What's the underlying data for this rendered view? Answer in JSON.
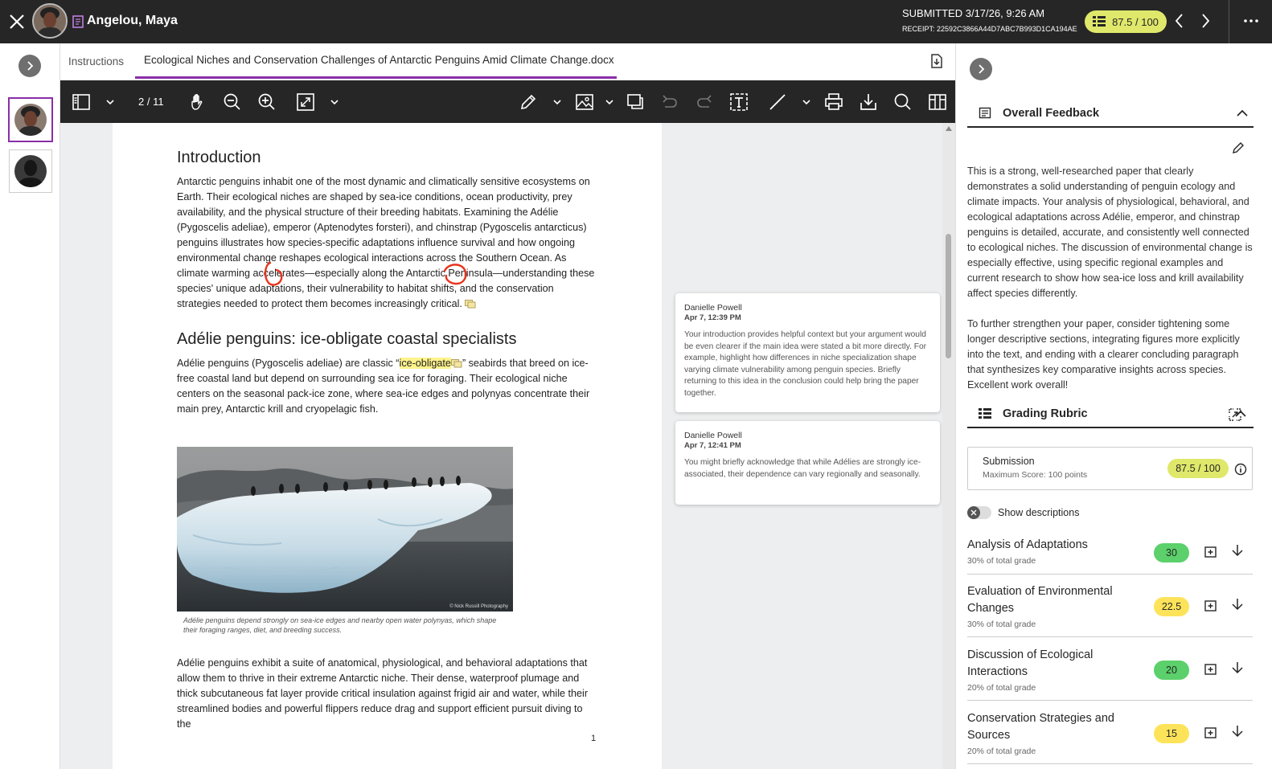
{
  "header": {
    "student_name": "Angelou, Maya",
    "submitted": "SUBMITTED 3/17/26, 9:26 AM",
    "receipt": "RECEIPT: 22592C3866A44D7ABC7B993D1CA194AE",
    "grade": "87.5 / 100"
  },
  "tabs": {
    "instructions": "Instructions",
    "document": "Ecological Niches and Conservation Challenges of Antarctic Penguins Amid Climate Change.docx"
  },
  "toolbar": {
    "page_indicator": "2 / 11"
  },
  "doc": {
    "intro_heading": "Introduction",
    "intro_text": "Antarctic penguins inhabit one of the most dynamic and climatically sensitive ecosystems on Earth. Their ecological niches are shaped by sea-ice conditions, ocean productivity, prey availability, and the physical structure of their breeding habitats. Examining the Adélie (Pygoscelis adeliae), emperor (Aptenodytes forsteri), and chinstrap (Pygoscelis antarcticus) penguins illustrates how species-specific adaptations influence survival and how ongoing environmental change reshapes ecological interactions across the Southern Ocean. As climate warming accelerates—especially along the Antarctic Peninsula—understanding these species' unique adaptations, their vulnerability to habitat shifts, and the conservation strategies needed to protect them becomes increasingly critical.",
    "adelie_heading": "Adélie penguins: ice-obligate coastal specialists",
    "adelie_before": "Adélie penguins (Pygoscelis adeliae) are classic “",
    "adelie_highlight": "ice-obligate",
    "adelie_after": "” seabirds that breed on ice-free coastal land but depend on surrounding sea ice for foraging. Their ecological niche centers on the seasonal pack-ice zone, where sea-ice edges and polynyas concentrate their main prey, Antarctic krill and cryopelagic fish.",
    "photo_credit": "© Nick Russill Photography",
    "caption": "Adélie penguins depend strongly on sea-ice edges and nearby open water polynyas, which shape their foraging ranges, diet, and breeding success.",
    "adaptations_text": "Adélie penguins exhibit a suite of anatomical, physiological, and behavioral adaptations that allow them to thrive in their extreme Antarctic niche. Their dense, waterproof plumage and thick subcutaneous fat layer provide critical insulation against frigid air and water, while their streamlined bodies and powerful flippers reduce drag and support efficient pursuit diving to the",
    "page_number": "1"
  },
  "comments": [
    {
      "author": "Danielle Powell",
      "date": "Apr 7, 12:39 PM",
      "text": "Your introduction provides helpful context but your argument would be even clearer if the main idea were stated a bit more directly. For example, highlight how differences in niche specialization shape varying climate vulnerability among penguin species. Briefly returning to this idea in the conclusion could help bring the paper together."
    },
    {
      "author": "Danielle Powell",
      "date": "Apr 7, 12:41 PM",
      "text": "You might briefly acknowledge that while Adélies are strongly ice-associated, their dependence can vary regionally and seasonally."
    }
  ],
  "feedback": {
    "title": "Overall Feedback",
    "p1": "This is a strong, well-researched paper that clearly demonstrates a solid understanding of penguin ecology and climate impacts. Your analysis of  physiological, behavioral, and ecological adaptations across Adélie, emperor, and chinstrap penguins is detailed, accurate, and consistently well connected to ecological niches. The discussion of environmental change is especially effective, using specific regional examples and current research to show how sea-ice loss and krill availability affect species differently.",
    "p2": "To further strengthen your paper, consider tightening some longer descriptive sections, integrating figures more explicitly into the text, and ending with a clearer concluding paragraph that synthesizes key comparative insights across species. Excellent work overall!"
  },
  "rubric": {
    "title": "Grading Rubric",
    "submission_label": "Submission",
    "max_score": "Maximum Score: 100 points",
    "total": "87.5 / 100",
    "show_descriptions": "Show descriptions",
    "criteria": [
      {
        "name": "Analysis of Adaptations",
        "pct": "30% of total grade",
        "score": "30",
        "color": "#5bd06b"
      },
      {
        "name": "Evaluation of Environmental Changes",
        "pct": "30% of total grade",
        "score": "22.5",
        "color": "#fde35a"
      },
      {
        "name": "Discussion of Ecological Interactions",
        "pct": "20% of total grade",
        "score": "20",
        "color": "#5bd06b"
      },
      {
        "name": "Conservation Strategies and Sources",
        "pct": "20% of total grade",
        "score": "15",
        "color": "#fde35a"
      }
    ]
  }
}
